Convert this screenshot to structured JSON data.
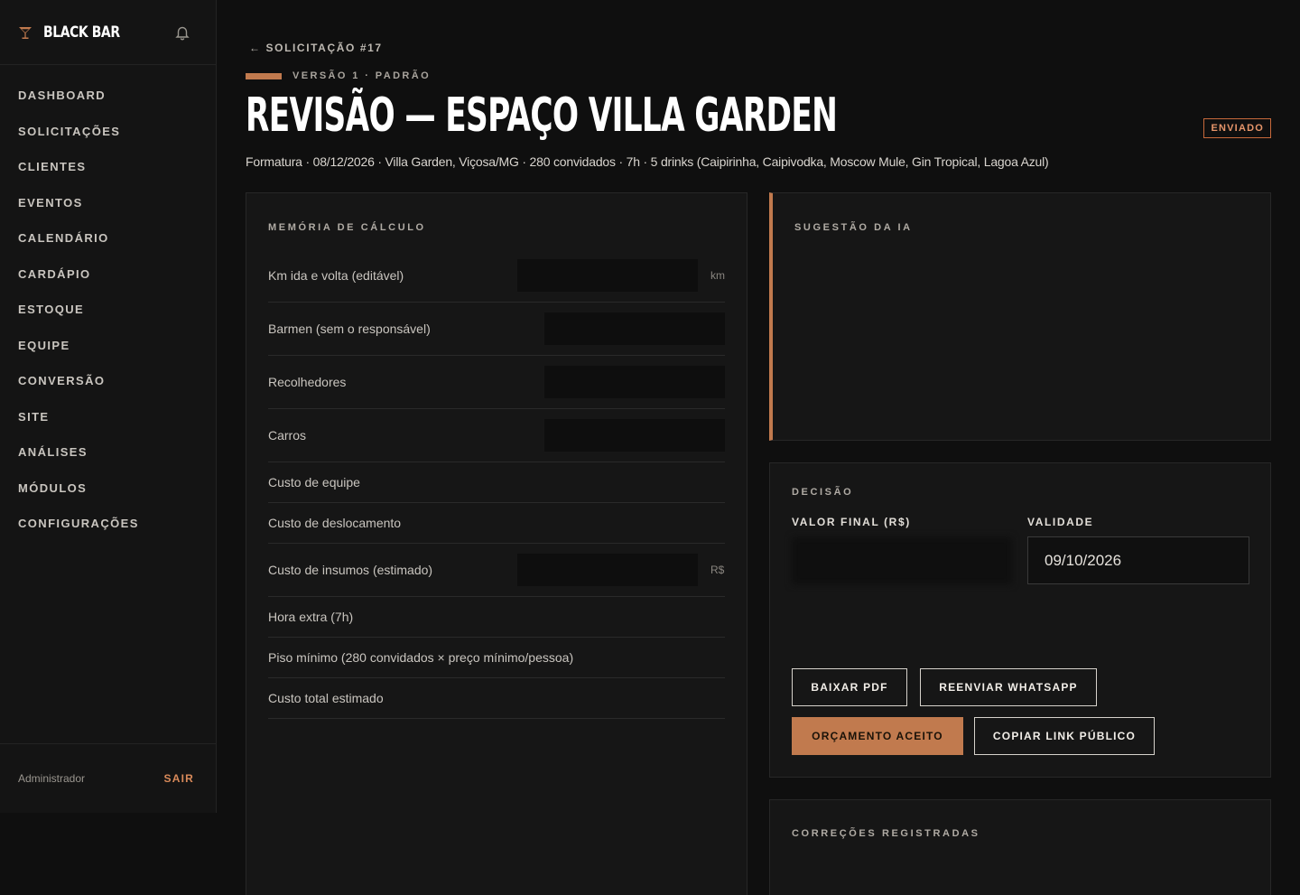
{
  "sidebar": {
    "brand": "BLACK BAR",
    "items": [
      {
        "label": "DASHBOARD"
      },
      {
        "label": "SOLICITAÇÕES"
      },
      {
        "label": "CLIENTES"
      },
      {
        "label": "EVENTOS"
      },
      {
        "label": "CALENDÁRIO"
      },
      {
        "label": "CARDÁPIO"
      },
      {
        "label": "ESTOQUE"
      },
      {
        "label": "EQUIPE"
      },
      {
        "label": "CONVERSÃO"
      },
      {
        "label": "SITE"
      },
      {
        "label": "ANÁLISES"
      },
      {
        "label": "MÓDULOS"
      },
      {
        "label": "CONFIGURAÇÕES"
      }
    ],
    "user_role": "Administrador",
    "logout": "SAIR"
  },
  "header": {
    "back_label": "← SOLICITAÇÃO #17",
    "version": "VERSÃO 1 · PADRÃO",
    "title": "REVISÃO — ESPAÇO VILLA GARDEN",
    "status": "ENVIADO",
    "subtitle": "Formatura · 08/12/2026 · Villa Garden, Viçosa/MG · 280 convidados · 7h · 5 drinks (Caipirinha, Caipivodka, Moscow Mule, Gin Tropical, Lagoa Azul)"
  },
  "calc": {
    "title": "MEMÓRIA DE CÁLCULO",
    "inputs": [
      {
        "label": "Km ida e volta (editável)",
        "value": "",
        "unit": "km"
      },
      {
        "label": "Barmen (sem o responsável)",
        "value": "",
        "unit": ""
      },
      {
        "label": "Recolhedores",
        "value": "",
        "unit": ""
      },
      {
        "label": "Carros",
        "value": "",
        "unit": ""
      }
    ],
    "rows_a": [
      {
        "label": "Custo de equipe",
        "value": ""
      },
      {
        "label": "Custo de deslocamento",
        "value": ""
      }
    ],
    "insumos": {
      "label": "Custo de insumos (estimado)",
      "value": "",
      "unit": "R$"
    },
    "rows_b": [
      {
        "label": "Hora extra (7h)",
        "value": ""
      },
      {
        "label": "Piso mínimo (280 convidados × preço mínimo/pessoa)",
        "value": ""
      },
      {
        "label": "Custo total estimado",
        "value": ""
      }
    ]
  },
  "ia": {
    "title": "SUGESTÃO DA IA",
    "price": "",
    "price_note": "",
    "text": "",
    "meta": ""
  },
  "decision": {
    "title": "DECISÃO",
    "final_label": "VALOR FINAL (R$)",
    "final_value": "",
    "validity_label": "VALIDADE",
    "validity_value": "09/10/2026",
    "margin_note": "",
    "note": "",
    "buttons": {
      "pdf": "BAIXAR PDF",
      "whatsapp": "REENVIAR WHATSAPP",
      "accepted": "ORÇAMENTO ACEITO",
      "copy_link": "COPIAR LINK PÚBLICO"
    }
  },
  "corrections": {
    "title": "CORREÇÕES REGISTRADAS",
    "text": ""
  },
  "colors": {
    "accent": "#c17a4e",
    "badge": "#c7693b",
    "success": "#2f9a64"
  }
}
